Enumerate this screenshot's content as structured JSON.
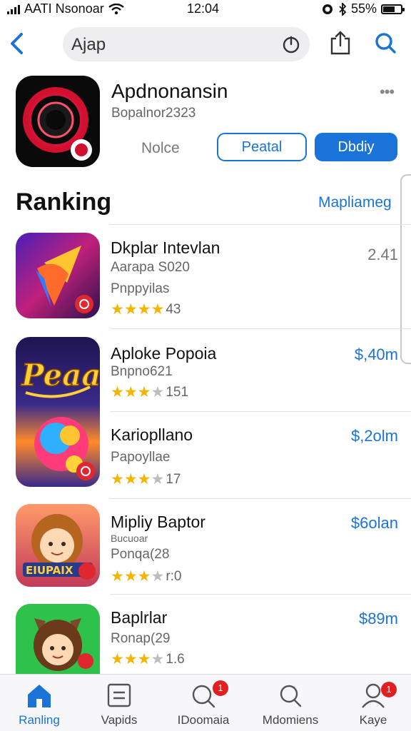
{
  "status_bar": {
    "carrier": "AATI Nsonoar",
    "time": "12:04",
    "battery": "55%"
  },
  "nav": {
    "search_value": "Ajap"
  },
  "app": {
    "title": "Apdnonansin",
    "subtitle": "Bopalnor2323",
    "more": "•••",
    "notice": "Nolce",
    "outline_button": "Peatal",
    "primary_button": "Dbdiy"
  },
  "section": {
    "title": "Ranking",
    "link": "Mapliameg"
  },
  "rankings": [
    {
      "name": "Dkplar Intevlan",
      "line1": "Aarapa S020",
      "line2": "Pnppyilas",
      "stars_full": 3,
      "stars_half": 1,
      "rating_count": "43",
      "price": "2.41"
    },
    {
      "name": "Aploke Popoia",
      "line1": "Bnpno621",
      "line2": "",
      "stars_full": 2,
      "stars_half": 1,
      "rating_count": "151",
      "price": "$,40m"
    },
    {
      "name": "Kariopllano",
      "line1": "Papoyllae",
      "line2": "",
      "stars_full": 3,
      "stars_half": 0,
      "rating_count": "17",
      "price": "$,2olm"
    },
    {
      "name": "Mipliy Baptor",
      "line1": "Bucuoar",
      "line2": "Ponqa(28",
      "stars_full": 3,
      "stars_half": 0,
      "rating_count": "r:0",
      "price": "$6olan"
    },
    {
      "name": "Baplrlar",
      "line1": "Ronap(29",
      "line2": "",
      "stars_full": 3,
      "stars_half": 0,
      "rating_count": "1.6",
      "price": "$89m"
    }
  ],
  "tabs": [
    {
      "label": "Ranling",
      "icon": "home-icon",
      "badge": ""
    },
    {
      "label": "Vapids",
      "icon": "apps-icon",
      "badge": ""
    },
    {
      "label": "IDoomaia",
      "icon": "search-icon",
      "badge": "1"
    },
    {
      "label": "Mdomiens",
      "icon": "magnifier-icon",
      "badge": ""
    },
    {
      "label": "Kaye",
      "icon": "person-icon",
      "badge": "1"
    }
  ],
  "colors": {
    "accent": "#1a73d9",
    "badge": "#e02020",
    "star": "#f4b400"
  }
}
